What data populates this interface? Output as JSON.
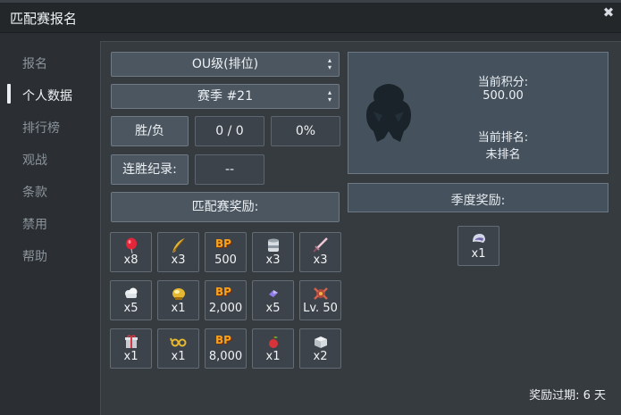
{
  "window": {
    "title": "匹配赛报名",
    "close_icon": "✖"
  },
  "sidebar": {
    "items": [
      {
        "label": "报名",
        "active": false
      },
      {
        "label": "个人数据",
        "active": true
      },
      {
        "label": "排行榜",
        "active": false
      },
      {
        "label": "观战",
        "active": false
      },
      {
        "label": "条款",
        "active": false
      },
      {
        "label": "禁用",
        "active": false
      },
      {
        "label": "帮助",
        "active": false
      }
    ]
  },
  "controls": {
    "format_select": "OU级(排位)",
    "season_select": "赛季 #21",
    "winloss_label": "胜/负",
    "winloss_value": "0 / 0",
    "win_percent": "0%",
    "streak_label": "连胜纪录:",
    "streak_value": "--",
    "match_rewards_label": "匹配赛奖励:"
  },
  "rewards": [
    {
      "icon": "balloon-icon",
      "qty": "x8"
    },
    {
      "icon": "feather-icon",
      "qty": "x3"
    },
    {
      "icon": "bp-icon",
      "bp": "BP",
      "qty": "500"
    },
    {
      "icon": "can-icon",
      "qty": "x3"
    },
    {
      "icon": "sword-icon",
      "qty": "x3"
    },
    {
      "icon": "cloud-item-icon",
      "qty": "x5"
    },
    {
      "icon": "golden-helmet-icon",
      "qty": "x1"
    },
    {
      "icon": "bp-icon",
      "bp": "BP",
      "qty": "2,000"
    },
    {
      "icon": "purple-gem-icon",
      "qty": "x5"
    },
    {
      "icon": "monster-icon",
      "qty": "Lv. 50"
    },
    {
      "icon": "gift-box-icon",
      "qty": "x1"
    },
    {
      "icon": "golden-glasses-icon",
      "qty": "x1"
    },
    {
      "icon": "bp-icon",
      "bp": "BP",
      "qty": "8,000"
    },
    {
      "icon": "apple-icon",
      "qty": "x1"
    },
    {
      "icon": "silver-box-icon",
      "qty": "x2"
    }
  ],
  "stats": {
    "score_label": "当前积分:",
    "score_value": "500.00",
    "rank_label": "当前排名:",
    "rank_value": "未排名"
  },
  "season_rewards": {
    "label": "季度奖励:",
    "items": [
      {
        "icon": "helmet-icon",
        "qty": "x1"
      }
    ]
  },
  "expire_text": "奖励过期: 6 天"
}
